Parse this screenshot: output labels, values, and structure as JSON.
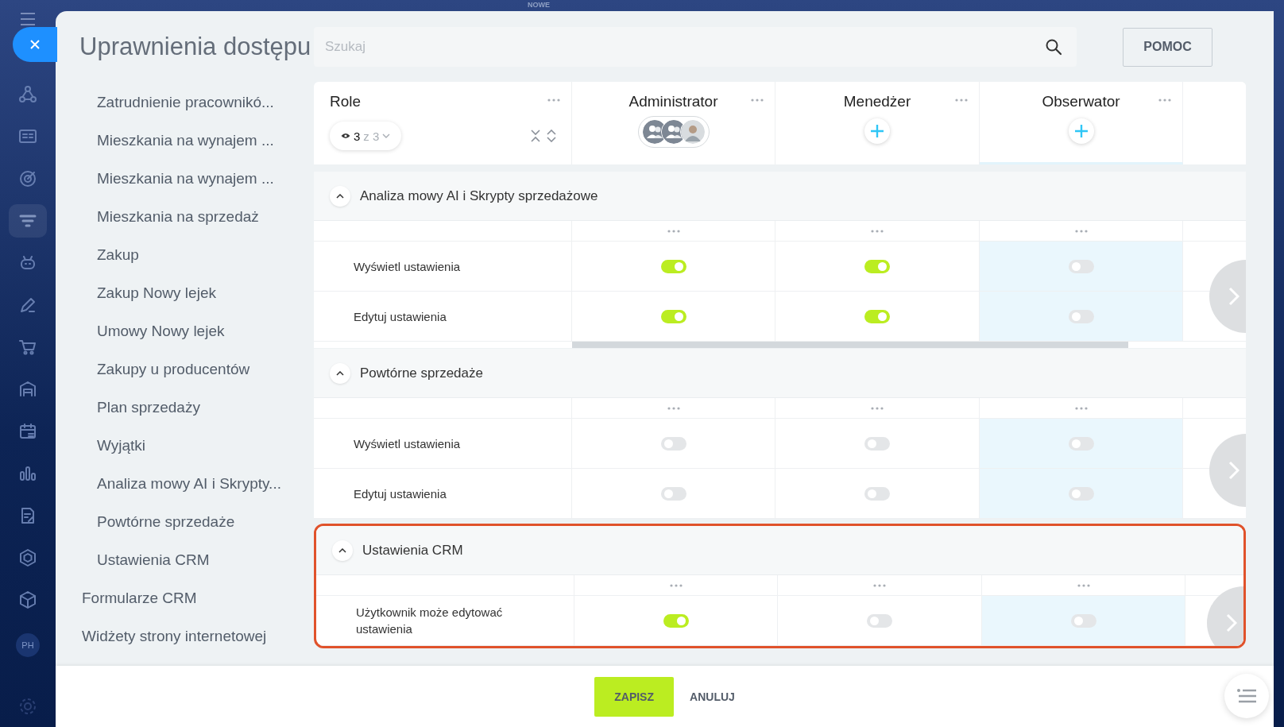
{
  "top_bar": {
    "badge": "NOWE"
  },
  "app_sidebar": {
    "avatar": "PH"
  },
  "title": "Uprawnienia dostępu",
  "search": {
    "placeholder": "Szukaj"
  },
  "help_button": "POMOC",
  "nav": [
    {
      "children": [
        {
          "label": "Zatrudnienie pracownikó..."
        },
        {
          "label": "Mieszkania na wynajem ..."
        },
        {
          "label": "Mieszkania na wynajem ..."
        },
        {
          "label": "Mieszkania na sprzedaż"
        },
        {
          "label": "Zakup"
        },
        {
          "label": "Zakup Nowy lejek"
        },
        {
          "label": "Umowy Nowy lejek"
        },
        {
          "label": "Zakupy u producentów"
        },
        {
          "label": "Plan sprzedaży"
        },
        {
          "label": "Wyjątki"
        },
        {
          "label": "Analiza mowy AI i Skrypty..."
        },
        {
          "label": "Powtórne sprzedaże"
        },
        {
          "label": "Ustawienia CRM"
        }
      ]
    },
    {
      "label": "Formularze CRM"
    },
    {
      "label": "Widżety strony internetowej"
    }
  ],
  "table": {
    "role_header": {
      "label": "Role",
      "filter": {
        "shown": "3",
        "total": "z 3"
      }
    },
    "roles": [
      {
        "name": "Administrator",
        "kind": "members",
        "highlighted": false
      },
      {
        "name": "Menedżer",
        "kind": "add",
        "highlighted": false
      },
      {
        "name": "Obserwator",
        "kind": "add",
        "highlighted": true
      }
    ],
    "sections": [
      {
        "title": "Analiza mowy AI i Skrypty sprzedażowe",
        "expanded": true,
        "highlighted": false,
        "scrollbar": true,
        "rows": [
          {
            "label": "Wyświetl ustawienia",
            "toggles": [
              {
                "on": true
              },
              {
                "on": true
              },
              {
                "on": false
              }
            ]
          },
          {
            "label": "Edytuj ustawienia",
            "toggles": [
              {
                "on": true
              },
              {
                "on": true
              },
              {
                "on": false
              }
            ]
          }
        ]
      },
      {
        "title": "Powtórne sprzedaże",
        "expanded": true,
        "highlighted": false,
        "scrollbar": false,
        "rows": [
          {
            "label": "Wyświetl ustawienia",
            "toggles": [
              {
                "on": false
              },
              {
                "on": false
              },
              {
                "on": false
              }
            ]
          },
          {
            "label": "Edytuj ustawienia",
            "toggles": [
              {
                "on": false
              },
              {
                "on": false
              },
              {
                "on": false
              }
            ]
          }
        ]
      },
      {
        "title": "Ustawienia CRM",
        "expanded": true,
        "highlighted": true,
        "scrollbar": false,
        "rows": [
          {
            "label": "Użytkownik może edytować ustawienia",
            "toggles": [
              {
                "on": true
              },
              {
                "on": false
              },
              {
                "on": false
              }
            ]
          }
        ]
      }
    ]
  },
  "footer": {
    "save": "ZAPISZ",
    "cancel": "ANULUJ"
  }
}
